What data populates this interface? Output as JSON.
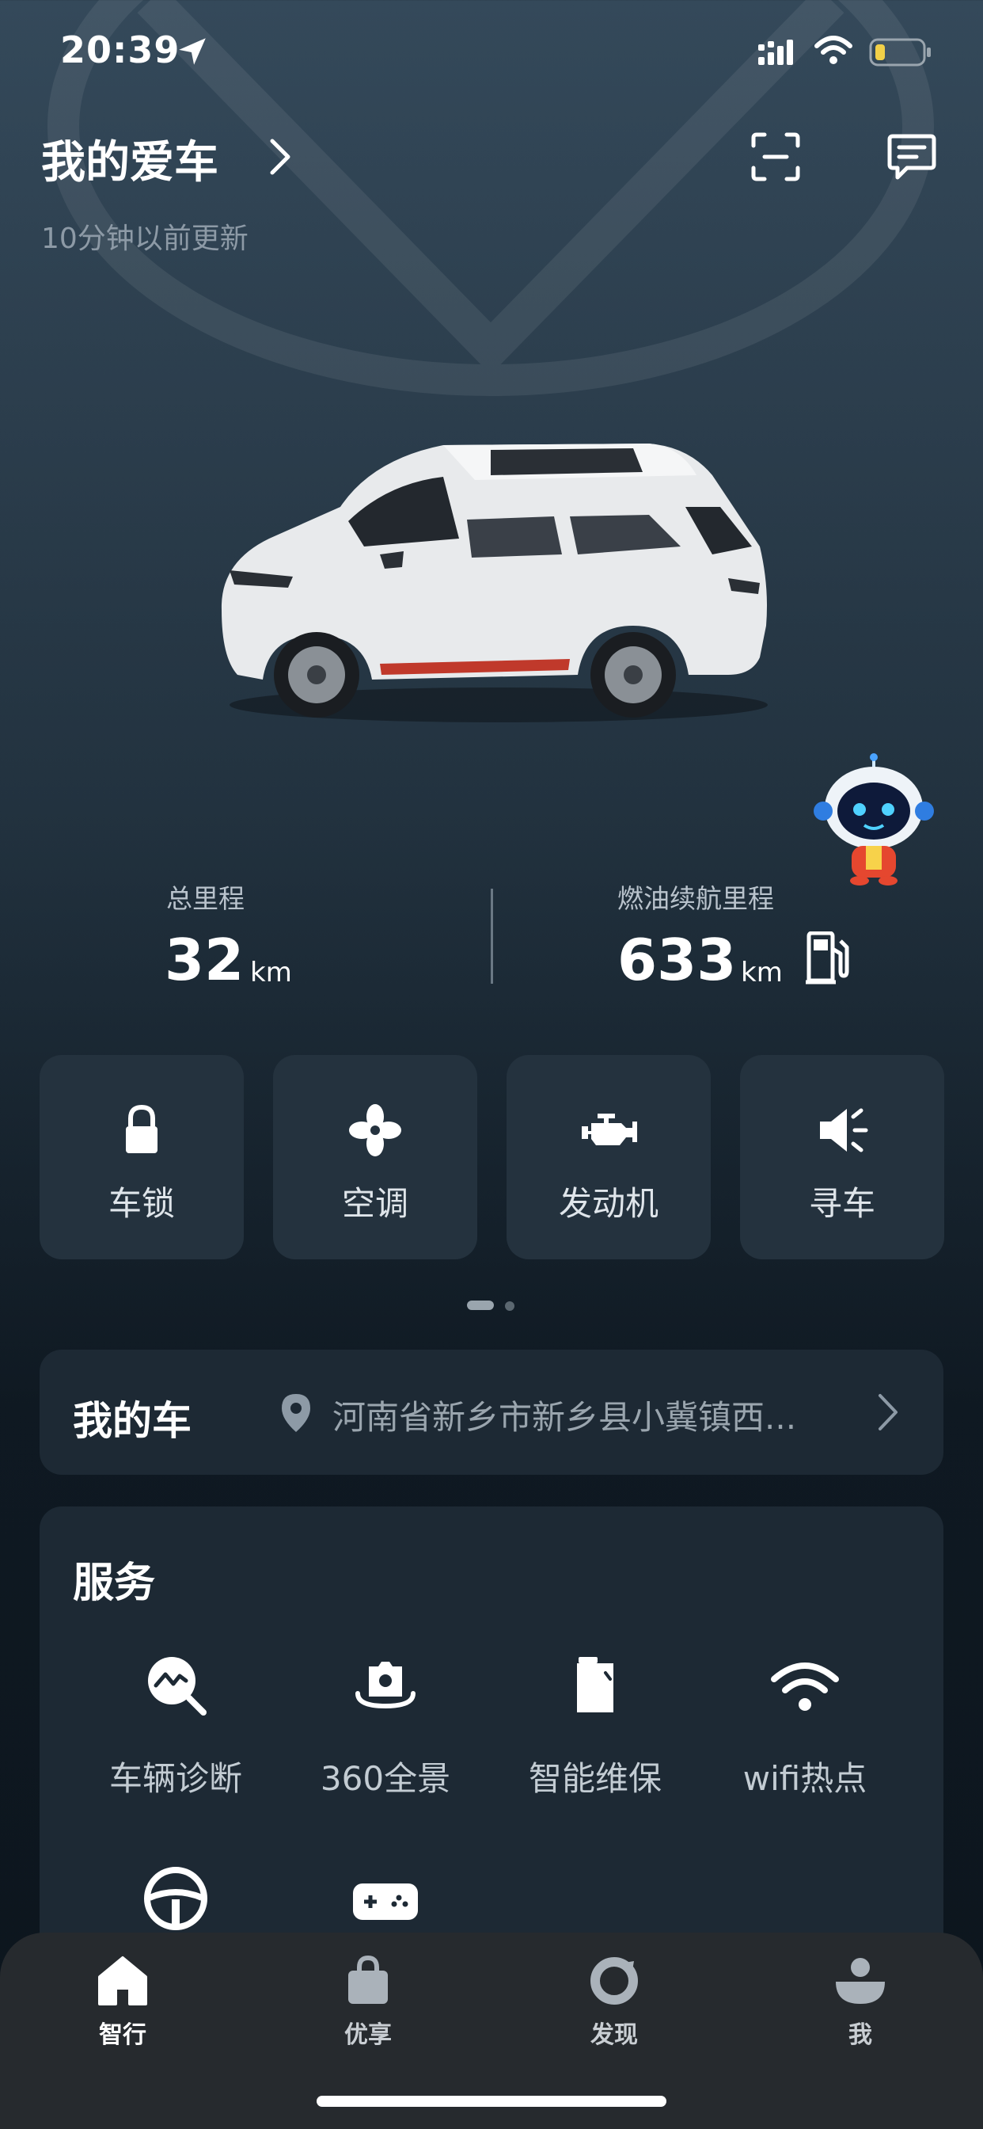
{
  "status_bar": {
    "time": "20:39"
  },
  "header": {
    "title": "我的爱车",
    "updated": "10分钟以前更新"
  },
  "mileage": {
    "total": {
      "label": "总里程",
      "value": "32",
      "unit": "km"
    },
    "fuel_range": {
      "label": "燃油续航里程",
      "value": "633",
      "unit": "km"
    }
  },
  "quick_controls": [
    {
      "label": "车锁",
      "icon": "lock-icon"
    },
    {
      "label": "空调",
      "icon": "fan-icon"
    },
    {
      "label": "发动机",
      "icon": "engine-icon"
    },
    {
      "label": "寻车",
      "icon": "horn-icon"
    }
  ],
  "my_car": {
    "title": "我的车",
    "address": "河南省新乡市新乡县小冀镇西..."
  },
  "services": {
    "title": "服务",
    "items": [
      {
        "label": "车辆诊断",
        "icon": "diagnosis-icon"
      },
      {
        "label": "360全景",
        "icon": "camera-360-icon"
      },
      {
        "label": "智能维保",
        "icon": "maintenance-icon"
      },
      {
        "label": "wifi热点",
        "icon": "wifi-hotspot-icon"
      },
      {
        "label": "",
        "icon": "steering-wheel-icon"
      },
      {
        "label": "",
        "icon": "gamepad-icon"
      }
    ]
  },
  "tabs": [
    {
      "label": "智行",
      "icon": "home-icon",
      "active": true
    },
    {
      "label": "优享",
      "icon": "shopping-bag-icon",
      "active": false
    },
    {
      "label": "发现",
      "icon": "discover-icon",
      "active": false
    },
    {
      "label": "我",
      "icon": "profile-icon",
      "active": false
    }
  ],
  "colors": {
    "card": "#24323e",
    "panel": "#1d2934",
    "tabbar": "#262a2e",
    "battery": "#f2d048"
  }
}
